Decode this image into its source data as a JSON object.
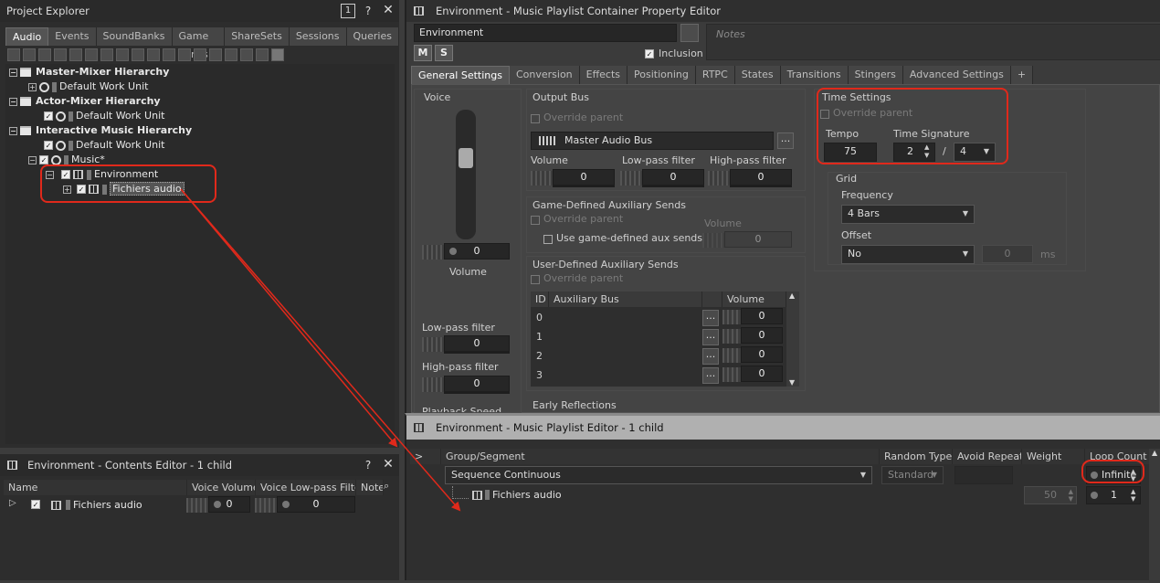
{
  "project_explorer": {
    "title": "Project Explorer",
    "tabs": [
      "Audio",
      "Events",
      "SoundBanks",
      "Game Syncs",
      "ShareSets",
      "Sessions",
      "Queries"
    ],
    "active_tab": "Audio",
    "tree": [
      {
        "label": "Master-Mixer Hierarchy",
        "bold": true
      },
      {
        "label": "Default Work Unit"
      },
      {
        "label": "Actor-Mixer Hierarchy",
        "bold": true
      },
      {
        "label": "Default Work Unit"
      },
      {
        "label": "Interactive Music Hierarchy",
        "bold": true
      },
      {
        "label": "Default Work Unit"
      },
      {
        "label": "Music*"
      },
      {
        "label": "Environment"
      },
      {
        "label": "Fichiers audio"
      }
    ]
  },
  "contents_editor": {
    "title": "Environment - Contents Editor - 1 child",
    "columns": [
      "Name",
      "Voice Volume",
      "Voice Low-pass Filter",
      "Notes"
    ],
    "row": {
      "name": "Fichiers audio",
      "voice_volume": "0",
      "voice_lpf": "0"
    }
  },
  "property_editor": {
    "title": "Environment - Music Playlist Container Property Editor",
    "name_value": "Environment",
    "notes_placeholder": "Notes",
    "m_label": "M",
    "s_label": "S",
    "inclusion_label": "Inclusion",
    "tabs": [
      "General Settings",
      "Conversion",
      "Effects",
      "Positioning",
      "RTPC",
      "States",
      "Transitions",
      "Stingers",
      "Advanced Settings",
      "+"
    ],
    "voice": {
      "title": "Voice",
      "volume_value": "0",
      "volume_label": "Volume",
      "lpf_label": "Low-pass filter",
      "lpf_value": "0",
      "hpf_label": "High-pass filter",
      "hpf_value": "0",
      "cut_label": "Playback Speed"
    },
    "output_bus": {
      "title": "Output Bus",
      "override": "Override parent",
      "bus": "Master Audio Bus",
      "volume_label": "Volume",
      "volume_value": "0",
      "lpf_label": "Low-pass filter",
      "lpf_value": "0",
      "hpf_label": "High-pass filter",
      "hpf_value": "0",
      "browse": "..."
    },
    "game_aux": {
      "title": "Game-Defined Auxiliary Sends",
      "override": "Override parent",
      "use_label": "Use game-defined aux sends",
      "volume_label": "Volume",
      "volume_value": "0"
    },
    "user_aux": {
      "title": "User-Defined Auxiliary Sends",
      "override": "Override parent",
      "cols": [
        "ID",
        "Auxiliary Bus",
        "Volume"
      ],
      "rows": [
        {
          "id": "0",
          "vol": "0"
        },
        {
          "id": "1",
          "vol": "0"
        },
        {
          "id": "2",
          "vol": "0"
        },
        {
          "id": "3",
          "vol": "0"
        }
      ],
      "browse": "..."
    },
    "early_reflections": {
      "title": "Early Reflections"
    },
    "time_settings": {
      "title": "Time Settings",
      "override": "Override parent",
      "tempo_label": "Tempo",
      "tempo": "75",
      "sig_label": "Time Signature",
      "sig_num": "2",
      "sig_sep": "/",
      "sig_den": "4"
    },
    "grid": {
      "title": "Grid",
      "frequency_label": "Frequency",
      "frequency": "4 Bars",
      "offset_label": "Offset",
      "offset": "No",
      "offset_value": "0",
      "offset_unit": "ms"
    }
  },
  "playlist_editor": {
    "title": "Environment - Music Playlist Editor - 1 child",
    "columns": [
      ">",
      "Group/Segment",
      "Random Type",
      "Avoid Repeat",
      "Weight",
      "Loop Count"
    ],
    "group_row": {
      "name": "Sequence Continuous",
      "random_type": "Standard",
      "loop": "Infinite"
    },
    "segment_row": {
      "name": "Fichiers audio",
      "weight": "50",
      "loop": "1"
    }
  },
  "colors": {
    "annotation": "#e0291b",
    "accent": "#5a5a5a"
  }
}
